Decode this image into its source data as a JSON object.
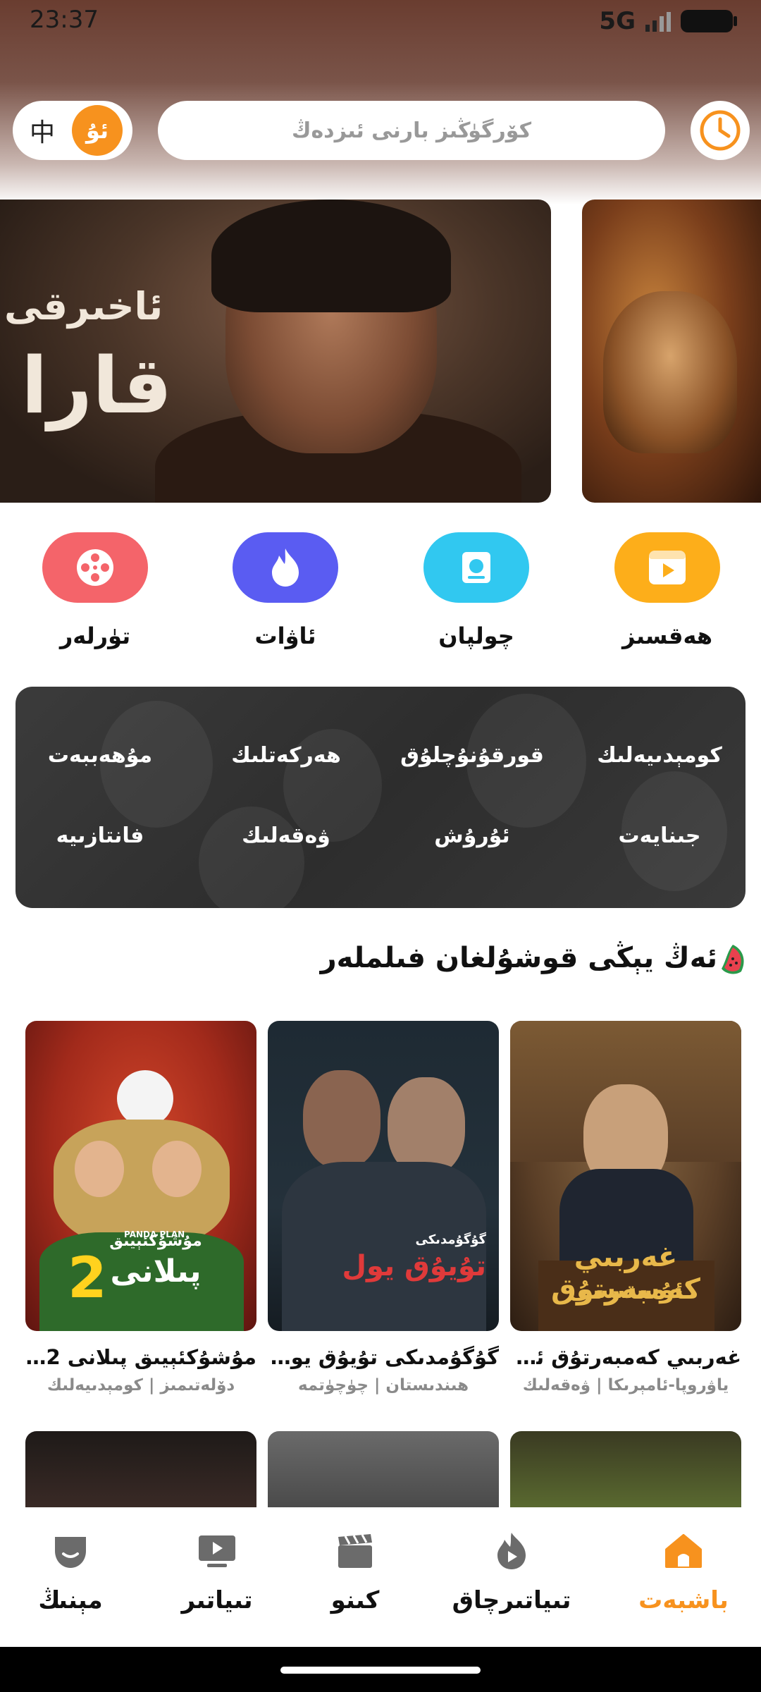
{
  "status_bar": {
    "time": "23:37",
    "network": "5G"
  },
  "header": {
    "lang_zh": "中",
    "lang_ug": "ئۇ",
    "search_placeholder": "كۆرگۈڭىز بارنى ئىزدەڭ"
  },
  "banner": {
    "title_line1": "ئاخىرقى",
    "title_line2": "قارا"
  },
  "categories": [
    {
      "label": "ھەقسىز",
      "color": "#fdae1a"
    },
    {
      "label": "چولپان",
      "color": "#31c8f0"
    },
    {
      "label": "ئاۋات",
      "color": "#5a5cf2"
    },
    {
      "label": "تۈرلەر",
      "color": "#f4646a"
    }
  ],
  "genres": {
    "row1": [
      "كومېدىيەلىك",
      "قورقۇنۇچلۇق",
      "ھەركەتلىك",
      "مۇھەببەت"
    ],
    "row2": [
      "جىنايەت",
      "ئۇرۇش",
      "ۋەقەلىك",
      "فانتازىيە"
    ]
  },
  "section": {
    "title": "ئەڭ يېڭى قوشۇلغان فىلملەر"
  },
  "movies": [
    {
      "title": "غەربىي كەمبەرتۇق ئۇست...",
      "meta": "ياۋروپا-ئامېرىكا | ۋەقەلىك"
    },
    {
      "title": "گۇگۇمدىكى تۇيۇق يول ...",
      "meta": "ھىندىستان | چۈچۈتمە"
    },
    {
      "title": "مۇشۇكئېيىق پىلانى 2: ...",
      "meta": "دۆلەتىمىز | كومېدىيەلىك"
    }
  ],
  "poster_texts": {
    "a_line1": "غەربىي كەمبەرتۇق",
    "a_line2": "ئۇستىسى",
    "b_small": "گۇگۇمدىكى",
    "b_big": "تۇيۇق يول",
    "c_line1": "مۇشۇكئېيىق",
    "c_line2": "پىلانى",
    "c_num": "2",
    "c_en": "PANDA PLAN"
  },
  "bottom_nav": [
    {
      "label": "باشبەت",
      "active": true
    },
    {
      "label": "تىياتىرچاق"
    },
    {
      "label": "كىنو"
    },
    {
      "label": "تىياتىر"
    },
    {
      "label": "مېنىڭ"
    }
  ],
  "colors": {
    "accent": "#f7921e",
    "panel": "#333333"
  }
}
